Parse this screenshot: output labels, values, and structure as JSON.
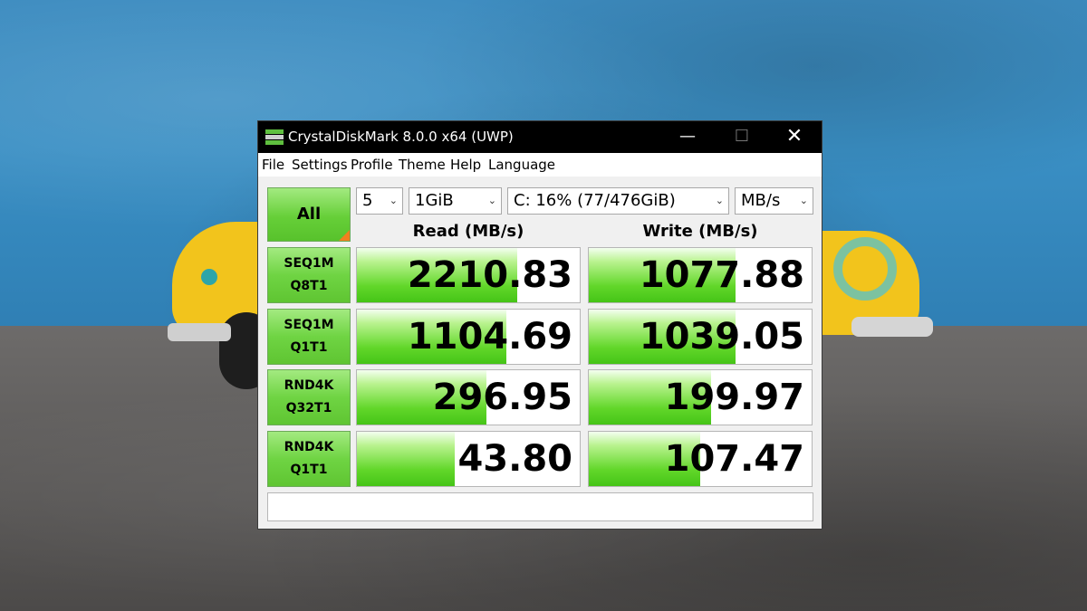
{
  "window": {
    "title": "CrystalDiskMark 8.0.0 x64 (UWP)",
    "controls": {
      "minimize": "—",
      "maximize": "☐",
      "close": "✕"
    }
  },
  "menu": [
    "File",
    "Settings",
    "Profile",
    "Theme",
    "Help",
    "Language"
  ],
  "toolbar": {
    "all_label": "All",
    "count": "5",
    "size": "1GiB",
    "drive": "C: 16% (77/476GiB)",
    "unit": "MB/s"
  },
  "headers": {
    "read": "Read (MB/s)",
    "write": "Write (MB/s)"
  },
  "rows": [
    {
      "line1": "SEQ1M",
      "line2": "Q8T1",
      "read": "2210.83",
      "write": "1077.88",
      "read_fill": 0.72,
      "write_fill": 0.66
    },
    {
      "line1": "SEQ1M",
      "line2": "Q1T1",
      "read": "1104.69",
      "write": "1039.05",
      "read_fill": 0.67,
      "write_fill": 0.66
    },
    {
      "line1": "RND4K",
      "line2": "Q32T1",
      "read": "296.95",
      "write": "199.97",
      "read_fill": 0.58,
      "write_fill": 0.55
    },
    {
      "line1": "RND4K",
      "line2": "Q1T1",
      "read": "43.80",
      "write": "107.47",
      "read_fill": 0.44,
      "write_fill": 0.5
    }
  ],
  "status": "",
  "colors": {
    "accent_green": "#62d72a",
    "corner_orange": "#f07f1f",
    "titlebar": "#000000"
  }
}
